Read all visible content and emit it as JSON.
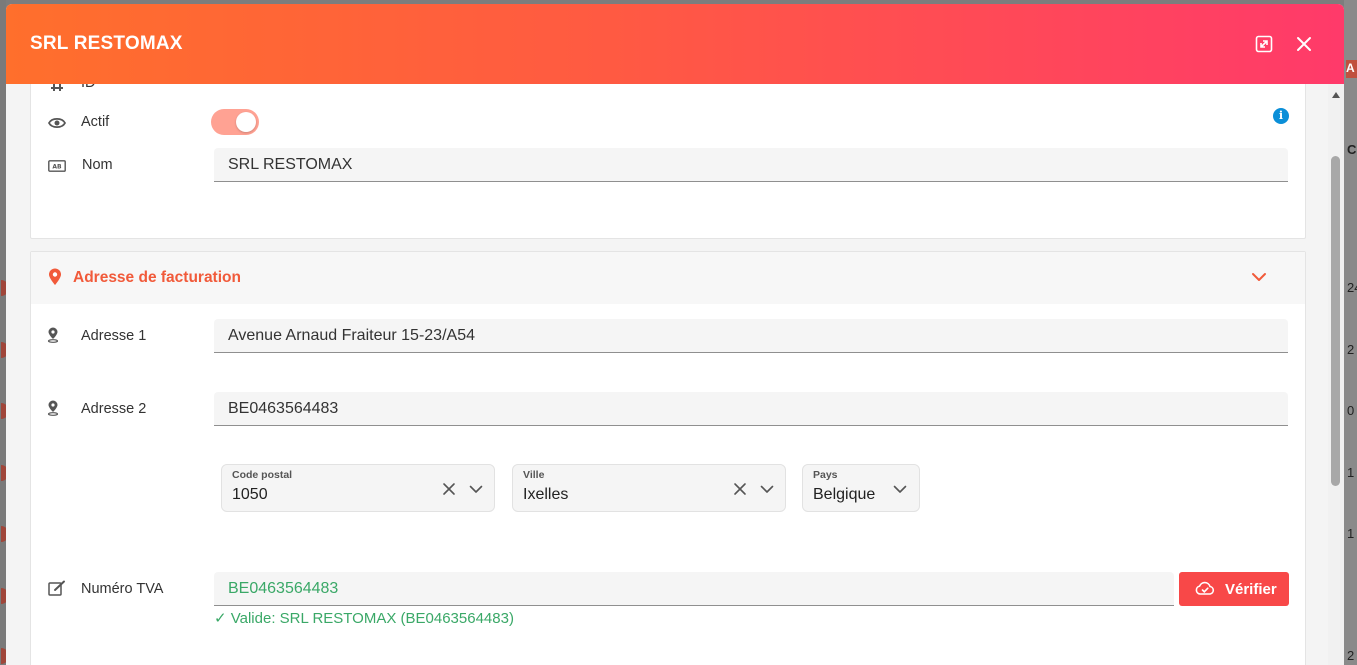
{
  "background": {
    "right_numbers": [
      "24",
      "2",
      "0",
      "1",
      "1",
      "2"
    ],
    "right_header_text": "Cr",
    "right_badge_text": "A"
  },
  "modal": {
    "title": "SRL RESTOMAX",
    "header_gradient": [
      "#ff6f2c",
      "#ff3a6a"
    ],
    "icons": {
      "expand": "expand-icon",
      "close": "close-icon"
    }
  },
  "general": {
    "id_label": "ID",
    "actif_label": "Actif",
    "actif_value": true,
    "nom_label": "Nom",
    "nom_value": "SRL RESTOMAX"
  },
  "billing": {
    "section_title": "Adresse de facturation",
    "accent_color": "#f15a3a",
    "adresse1_label": "Adresse 1",
    "adresse1_value": "Avenue Arnaud Fraiteur 15-23/A54",
    "adresse2_label": "Adresse 2",
    "adresse2_value": "BE0463564483",
    "code_postal": {
      "label": "Code postal",
      "value": "1050"
    },
    "ville": {
      "label": "Ville",
      "value": "Ixelles"
    },
    "pays": {
      "label": "Pays",
      "value": "Belgique"
    },
    "tva_label": "Numéro TVA",
    "tva_value": "BE0463564483",
    "verify_label": "Vérifier",
    "valid_message": "✓ Valide: SRL RESTOMAX (BE0463564483)",
    "valid_color": "#3aa867"
  }
}
